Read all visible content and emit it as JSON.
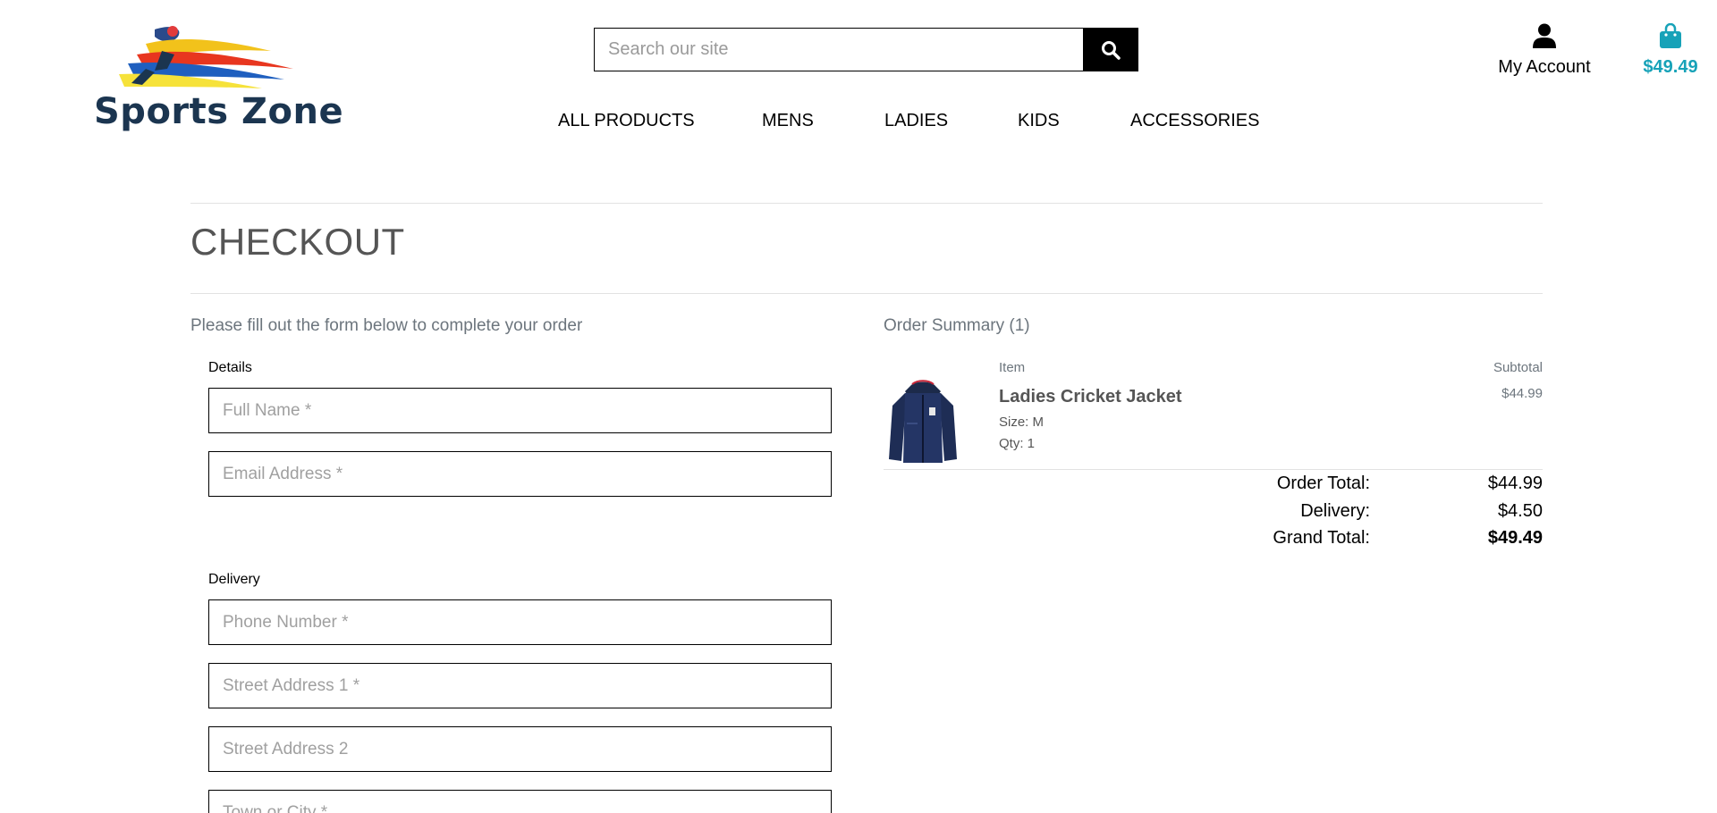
{
  "brand": {
    "name": "Sports Zone"
  },
  "search": {
    "placeholder": "Search our site"
  },
  "account": {
    "label": "My Account"
  },
  "bag": {
    "total": "$49.49"
  },
  "nav": {
    "items": [
      {
        "label": "ALL PRODUCTS"
      },
      {
        "label": "MENS"
      },
      {
        "label": "LADIES"
      },
      {
        "label": "KIDS"
      },
      {
        "label": "ACCESSORIES"
      }
    ]
  },
  "page": {
    "title": "CHECKOUT",
    "form_intro": "Please fill out the form below to complete your order"
  },
  "form": {
    "details_label": "Details",
    "delivery_label": "Delivery",
    "fields": {
      "full_name": "Full Name *",
      "email": "Email Address *",
      "phone": "Phone Number *",
      "street1": "Street Address 1 *",
      "street2": "Street Address 2",
      "town": "Town or City *"
    }
  },
  "summary": {
    "title": "Order Summary (1)",
    "col_item": "Item",
    "col_subtotal": "Subtotal",
    "items": [
      {
        "name": "Ladies Cricket Jacket",
        "size": "Size: M",
        "qty": "Qty: 1",
        "subtotal": "$44.99"
      }
    ],
    "order_total_label": "Order Total:",
    "order_total": "$44.99",
    "delivery_label": "Delivery:",
    "delivery": "$4.50",
    "grand_total_label": "Grand Total:",
    "grand_total": "$49.49"
  },
  "colors": {
    "accent": "#17a2b8",
    "brand_text": "#1b3550",
    "muted": "#6c757d"
  },
  "icons": {
    "search": "search-icon",
    "account": "user-icon",
    "bag": "shopping-bag-icon"
  }
}
